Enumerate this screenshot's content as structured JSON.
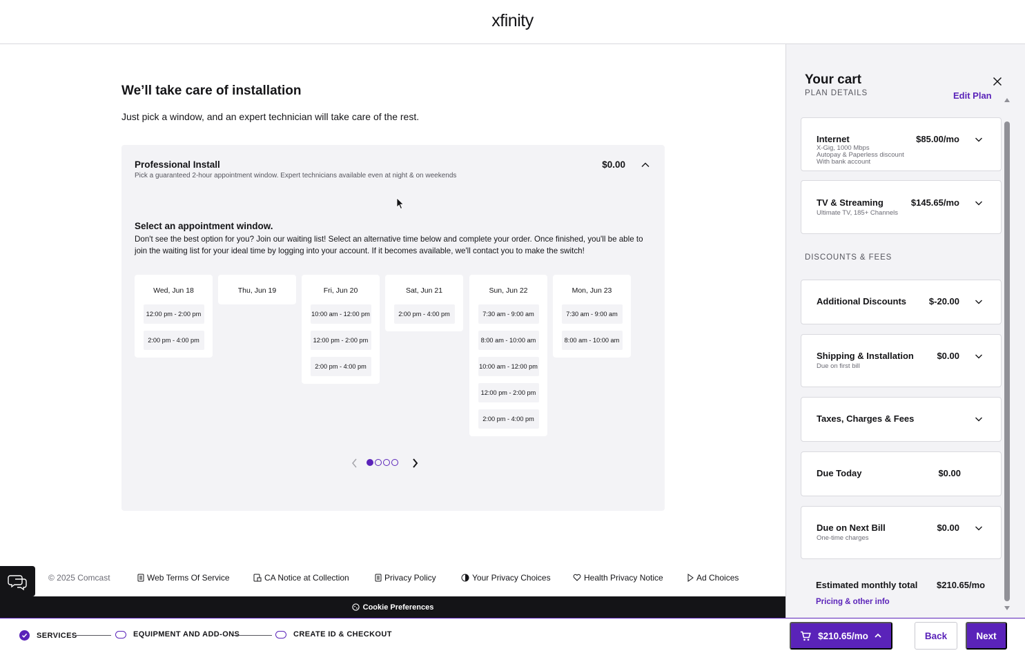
{
  "header": {
    "logo": "xfinity"
  },
  "main": {
    "title": "We’ll take care of installation",
    "subtitle": "Just pick a window, and an expert technician will take care of the rest.",
    "install": {
      "title": "Professional Install",
      "description": "Pick a guaranteed 2-hour appointment window. Expert technicians available even at night & on weekends",
      "price": "$0.00"
    },
    "appointment": {
      "title": "Select an appointment window.",
      "text": "Don't see the best option for you? Join our waiting list! Select an alternative time below and complete your order. Once finished, you'll be able to join the waiting list for your ideal time by logging into your account. If it becomes available, we'll contact you to make the switch!",
      "days": [
        {
          "label": "Wed, Jun 18",
          "slots": [
            "12:00 pm - 2:00 pm",
            "2:00 pm - 4:00 pm"
          ]
        },
        {
          "label": "Thu, Jun 19",
          "slots": []
        },
        {
          "label": "Fri, Jun 20",
          "slots": [
            "10:00 am - 12:00 pm",
            "12:00 pm - 2:00 pm",
            "2:00 pm - 4:00 pm"
          ]
        },
        {
          "label": "Sat, Jun 21",
          "slots": [
            "2:00 pm - 4:00 pm"
          ]
        },
        {
          "label": "Sun, Jun 22",
          "slots": [
            "7:30 am - 9:00 am",
            "8:00 am - 10:00 am",
            "10:00 am - 12:00 pm",
            "12:00 pm - 2:00 pm",
            "2:00 pm - 4:00 pm"
          ]
        },
        {
          "label": "Mon, Jun 23",
          "slots": [
            "7:30 am - 9:00 am",
            "8:00 am - 10:00 am"
          ]
        }
      ],
      "pager": {
        "pages": 4,
        "active": 1
      }
    }
  },
  "footer": {
    "copyright": "© 2025 Comcast",
    "links": [
      "Web Terms Of Service",
      "CA Notice at Collection",
      "Privacy Policy",
      "Your Privacy Choices",
      "Health Privacy Notice",
      "Ad Choices"
    ],
    "cookie": "Cookie Preferences"
  },
  "steps": [
    {
      "label": "SERVICES",
      "done": true
    },
    {
      "label": "EQUIPMENT AND ADD-ONS",
      "done": false
    },
    {
      "label": "CREATE ID & CHECKOUT",
      "done": false
    }
  ],
  "actions": {
    "cart_total": "$210.65/mo",
    "back": "Back",
    "next": "Next"
  },
  "cart": {
    "title": "Your cart",
    "plan_label": "PLAN DETAILS",
    "edit_plan": "Edit Plan",
    "items": [
      {
        "name": "Internet",
        "price": "$85.00/mo",
        "sub": [
          "X-Gig, 1000 Mbps",
          "Autopay & Paperless discount",
          "With bank account"
        ]
      },
      {
        "name": "TV & Streaming",
        "price": "$145.65/mo",
        "sub": [
          "Ultimate TV, 185+ Channels"
        ]
      }
    ],
    "discounts_label": "DISCOUNTS & FEES",
    "fees": [
      {
        "name": "Additional Discounts",
        "price": "$-20.00",
        "sub": []
      },
      {
        "name": "Shipping & Installation",
        "price": "$0.00",
        "sub": [
          "Due on first bill"
        ]
      },
      {
        "name": "Taxes, Charges & Fees",
        "price": "",
        "sub": []
      },
      {
        "name": "Due Today",
        "price": "$0.00",
        "sub": []
      },
      {
        "name": "Due on Next Bill",
        "price": "$0.00",
        "sub": [
          "One-time charges"
        ]
      }
    ],
    "estimated_label": "Estimated monthly total",
    "estimated_value": "$210.65/mo",
    "pricing_link": "Pricing & other info"
  },
  "colors": {
    "brand": "#5a23b9",
    "text": "#141417",
    "panel": "#f3f3f6"
  }
}
